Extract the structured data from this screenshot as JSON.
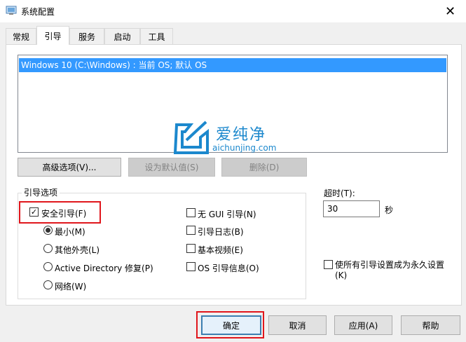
{
  "window": {
    "title": "系统配置",
    "close_glyph": "✕"
  },
  "tabs": [
    {
      "label": "常规"
    },
    {
      "label": "引导"
    },
    {
      "label": "服务"
    },
    {
      "label": "启动"
    },
    {
      "label": "工具"
    }
  ],
  "active_tab": "引导",
  "boot_list": {
    "items": [
      "Windows 10 (C:\\Windows) : 当前 OS; 默认 OS"
    ],
    "selected_index": 0
  },
  "watermark": {
    "brand": "爱纯净",
    "url": "aichunjing.com"
  },
  "list_buttons": {
    "advanced": "高级选项(V)...",
    "set_default": "设为默认值(S)",
    "delete": "删除(D)"
  },
  "boot_options": {
    "group_label": "引导选项",
    "safe_boot": {
      "label": "安全引导(F)",
      "checked": true
    },
    "radios": [
      {
        "label": "最小(M)",
        "selected": true
      },
      {
        "label": "其他外壳(L)",
        "selected": false
      },
      {
        "label": "Active Directory 修复(P)",
        "selected": false
      },
      {
        "label": "网络(W)",
        "selected": false
      }
    ],
    "checkboxes": [
      {
        "label": "无 GUI 引导(N)",
        "checked": false
      },
      {
        "label": "引导日志(B)",
        "checked": false
      },
      {
        "label": "基本视频(E)",
        "checked": false
      },
      {
        "label": "OS 引导信息(O)",
        "checked": false
      }
    ]
  },
  "timeout": {
    "label": "超时(T):",
    "value": "30",
    "unit": "秒"
  },
  "permanent": {
    "label_line1": "使所有引导设置成为永久设置",
    "label_line2": "(K)",
    "checked": false
  },
  "dialog_buttons": {
    "ok": "确定",
    "cancel": "取消",
    "apply": "应用(A)",
    "help": "帮助"
  },
  "colors": {
    "selection": "#3399ff",
    "highlight_box": "#e0161c",
    "watermark": "#1c88cd"
  }
}
